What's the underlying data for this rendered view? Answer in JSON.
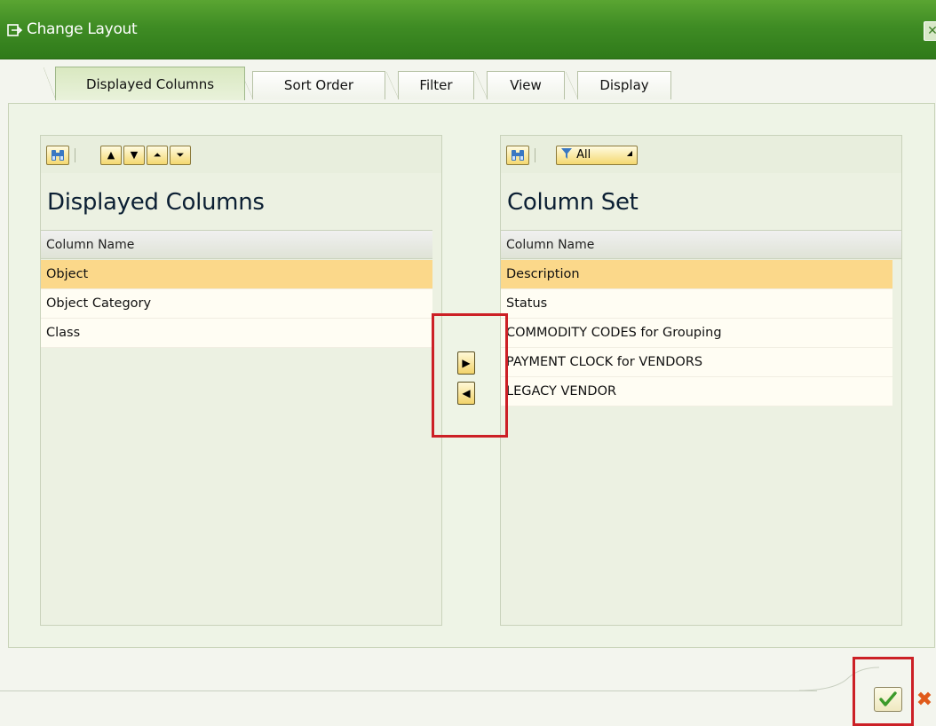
{
  "window": {
    "title": "Change Layout",
    "close_label": "✕",
    "accent_color": "#3f8c24"
  },
  "tabs": [
    {
      "label": "Displayed Columns",
      "active": true
    },
    {
      "label": "Sort Order",
      "active": false
    },
    {
      "label": "Filter",
      "active": false
    },
    {
      "label": "View",
      "active": false
    },
    {
      "label": "Display",
      "active": false
    }
  ],
  "left_panel": {
    "toolbar": {
      "buttons": [
        "find-icon",
        "move-up-icon",
        "move-down-icon",
        "move-to-top-icon",
        "move-to-bottom-icon"
      ]
    },
    "title": "Displayed Columns",
    "column_header": "Column Name",
    "rows": [
      {
        "label": "Object",
        "selected": true
      },
      {
        "label": "Object Category",
        "selected": false
      },
      {
        "label": "Class",
        "selected": false
      }
    ]
  },
  "right_panel": {
    "toolbar": {
      "buttons": [
        "find-icon",
        "filter-icon"
      ],
      "filter_label": "All"
    },
    "title": "Column Set",
    "column_header": "Column Name",
    "rows": [
      {
        "label": "Description",
        "selected": true
      },
      {
        "label": "Status",
        "selected": false
      },
      {
        "label": "COMMODITY CODES for Grouping",
        "selected": false
      },
      {
        "label": "PAYMENT CLOCK for VENDORS",
        "selected": false
      },
      {
        "label": "LEGACY VENDOR",
        "selected": false
      }
    ]
  },
  "transfer": {
    "add_icon": "arrow-right-icon",
    "remove_icon": "arrow-left-icon"
  },
  "footer": {
    "confirm_icon": "checkmark-icon",
    "cancel_icon": "cancel-x-icon",
    "highlight_color": "#cc2026"
  }
}
